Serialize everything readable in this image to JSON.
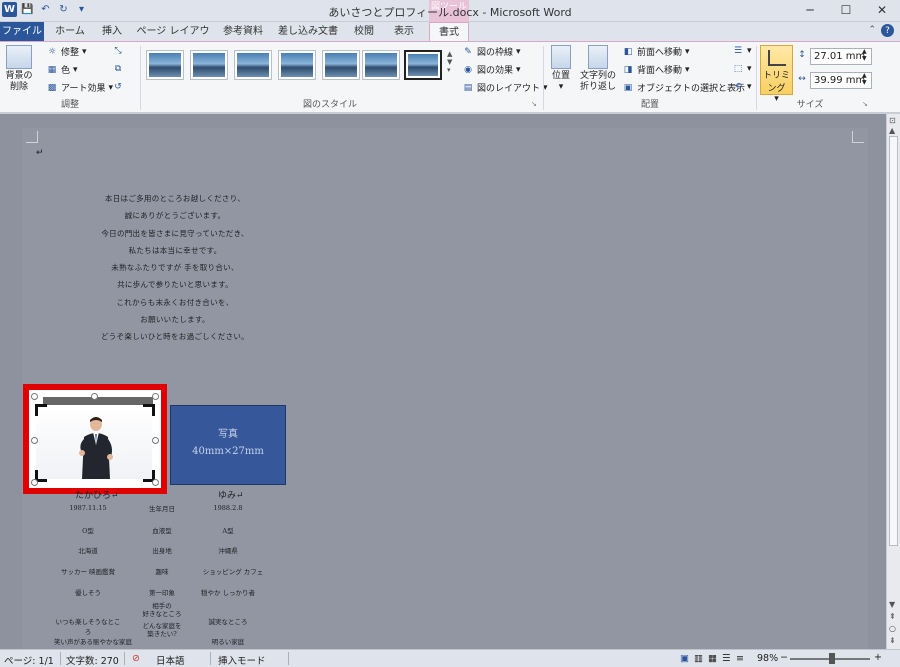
{
  "window": {
    "title": "あいさつとプロフィール.docx - Microsoft Word",
    "context_tab_header": "図ツール",
    "minimize": "─",
    "maximize": "☐",
    "close": "✕"
  },
  "qat": {
    "word": "W",
    "save": "💾",
    "undo": "↶",
    "redo": "↻",
    "more": "▾"
  },
  "tabs": [
    "ファイル",
    "ホーム",
    "挿入",
    "ページ レイアウト",
    "参考資料",
    "差し込み文書",
    "校閲",
    "表示",
    "書式"
  ],
  "active_tab": "書式",
  "ribbon": {
    "adjust": {
      "remove_bg": "背景の\n削除",
      "corrections": "修整",
      "color": "色",
      "art_effects": "アート効果",
      "label": "調整"
    },
    "styles": {
      "border": "図の枠線",
      "effects": "図の効果",
      "layout": "図のレイアウト",
      "label": "図のスタイル"
    },
    "arrange": {
      "position": "位置",
      "wrap": "文字列の\n折り返し",
      "bring_forward": "前面へ移動",
      "send_backward": "背面へ移動",
      "selection_pane": "オブジェクトの選択と表示",
      "label": "配置"
    },
    "size": {
      "crop": "トリミング",
      "height": "27.01 mm",
      "width": "39.99 mm",
      "label": "サイズ"
    }
  },
  "document": {
    "poem": [
      "本日はご多用のところお越しくださり、",
      "誠にありがとうございます。",
      "今日の門出を皆さまに見守っていただき、",
      "私たちは本当に幸せです。",
      "未熟なふたりですが 手を取り合い、",
      "共に歩んで参りたいと思います。",
      "これからも末永くお付き合いを、",
      "お願いいたします。",
      "どうぞ楽しいひと時をお過ごしください。"
    ],
    "placeholder_box": {
      "line1": "写真",
      "line2": "40mm×27mm"
    },
    "name_left": "たかひろ↵",
    "name_right": "ゆみ↵",
    "profile_rows": [
      [
        "1987.11.15",
        "生年月日",
        "1988.2.8"
      ],
      [
        "O型",
        "血液型",
        "A型"
      ],
      [
        "北海道",
        "出身地",
        "沖縄県"
      ],
      [
        "サッカー 映画鑑賞",
        "趣味",
        "ショッピング カフェ"
      ],
      [
        "優しそう",
        "第一印象",
        "穏やか しっかり者"
      ],
      [
        "いつも楽しそうなところ",
        "相手の\n好きなところ",
        "誠実なところ"
      ],
      [
        "笑い声がある賑やかな家庭",
        "どんな家庭を\n築きたい?",
        "明るい家庭"
      ]
    ]
  },
  "status": {
    "page": "ページ: 1/1",
    "words": "文字数: 270",
    "lang": "日本語",
    "mode": "挿入モード",
    "zoom": "98%",
    "zoom_minus": "−",
    "zoom_plus": "+"
  },
  "colors": {
    "accent": "#2b579a",
    "highlight": "#e00000",
    "placeholder": "#36589a",
    "crop_button": "#f7cf62"
  }
}
